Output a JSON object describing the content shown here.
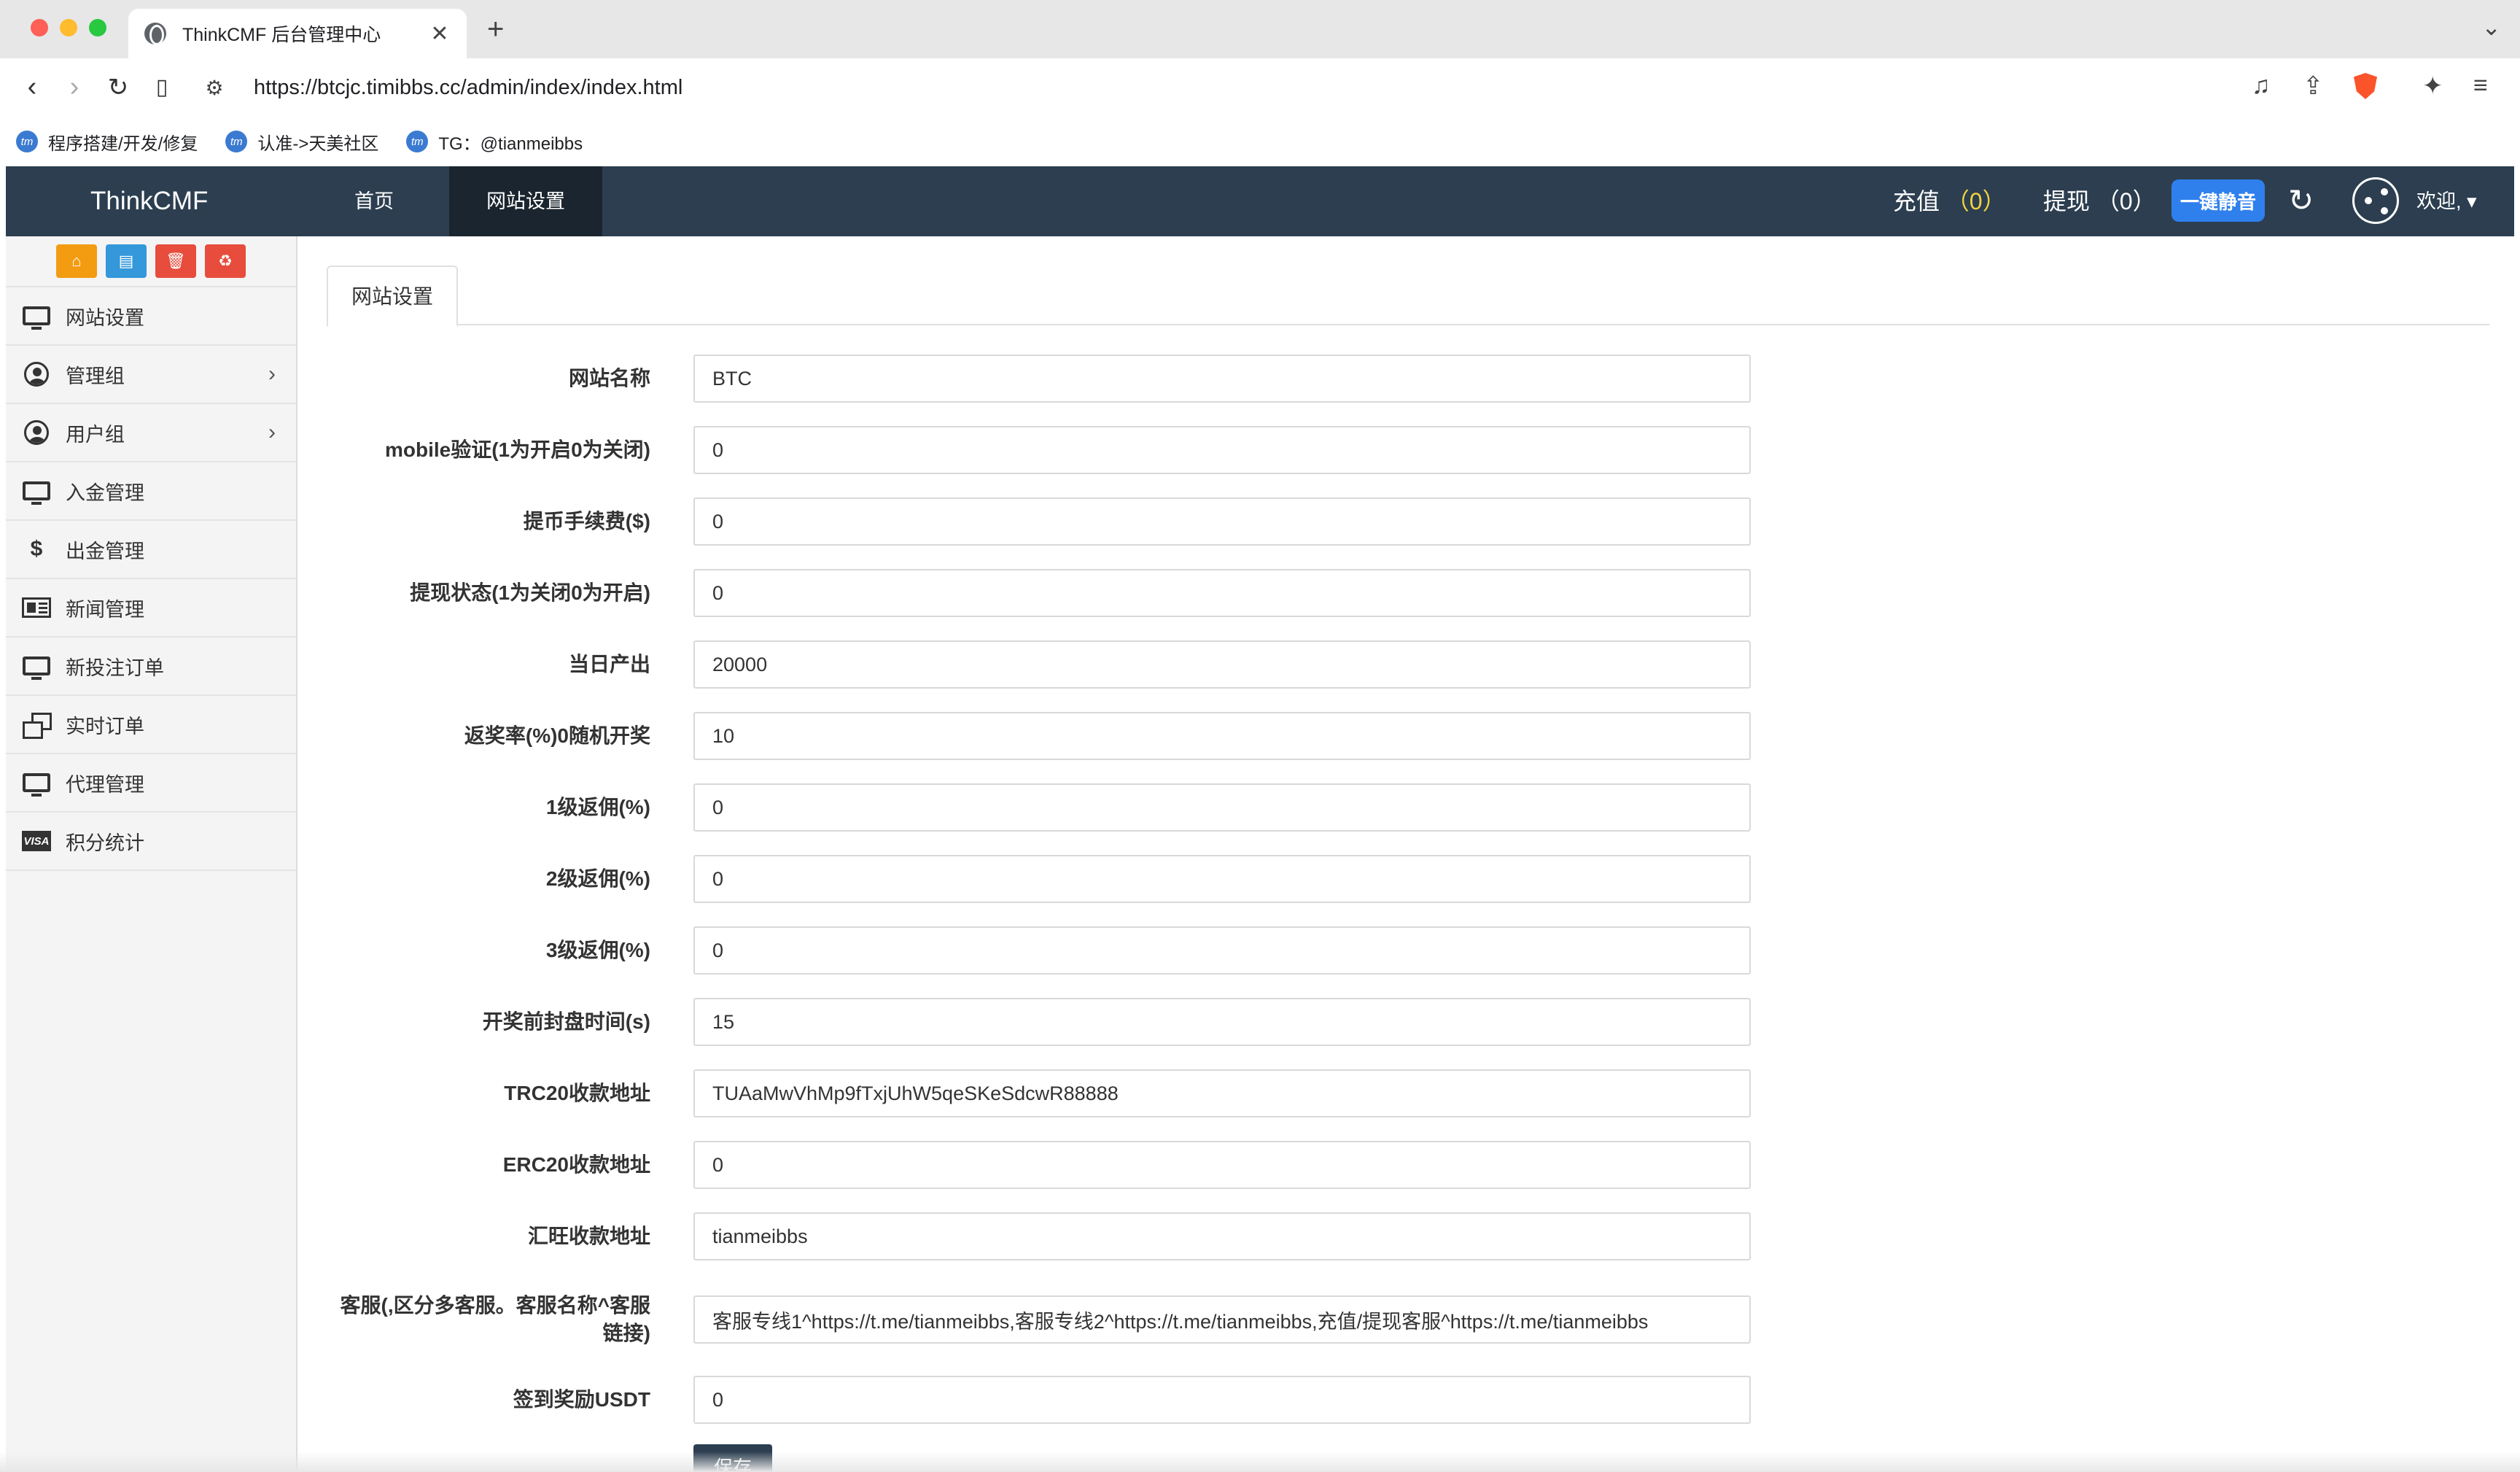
{
  "browser": {
    "tab_title": "ThinkCMF 后台管理中心",
    "tab_close": "✕",
    "new_tab": "+",
    "url": "https://btcjc.timibbs.cc/admin/index/index.html",
    "bookmarks": [
      {
        "label": "程序搭建/开发/修复"
      },
      {
        "label": "认准->天美社区"
      },
      {
        "label": "TG：@tianmeibbs"
      }
    ]
  },
  "navbar": {
    "brand": "ThinkCMF",
    "home": "首页",
    "site_settings": "网站设置",
    "recharge_label": "充值",
    "recharge_count": "0",
    "withdraw_label": "提现",
    "withdraw_count": "0",
    "mute_button": "一键静音",
    "welcome": "欢迎,"
  },
  "sidebar": {
    "items": [
      {
        "label": "网站设置",
        "icon": "monitor-icon"
      },
      {
        "label": "管理组",
        "icon": "user-circle-icon",
        "has_children": true
      },
      {
        "label": "用户组",
        "icon": "user-circle-icon",
        "has_children": true
      },
      {
        "label": "入金管理",
        "icon": "monitor-icon"
      },
      {
        "label": "出金管理",
        "icon": "dollar-icon"
      },
      {
        "label": "新闻管理",
        "icon": "newspaper-icon"
      },
      {
        "label": "新投注订单",
        "icon": "monitor-icon"
      },
      {
        "label": "实时订单",
        "icon": "clone-icon"
      },
      {
        "label": "代理管理",
        "icon": "monitor-icon"
      },
      {
        "label": "积分统计",
        "icon": "visa-icon"
      }
    ]
  },
  "page": {
    "tab": "网站设置",
    "fields": [
      {
        "label": "网站名称",
        "value": "BTC"
      },
      {
        "label": "mobile验证(1为开启0为关闭)",
        "value": "0"
      },
      {
        "label": "提币手续费($)",
        "value": "0"
      },
      {
        "label": "提现状态(1为关闭0为开启)",
        "value": "0"
      },
      {
        "label": "当日产出",
        "value": "20000"
      },
      {
        "label": "返奖率(%)0随机开奖",
        "value": "10"
      },
      {
        "label": "1级返佣(%)",
        "value": "0"
      },
      {
        "label": "2级返佣(%)",
        "value": "0"
      },
      {
        "label": "3级返佣(%)",
        "value": "0"
      },
      {
        "label": "开奖前封盘时间(s)",
        "value": "15"
      },
      {
        "label": "TRC20收款地址",
        "value": "TUAaMwVhMp9fTxjUhW5qeSKeSdcwR88888"
      },
      {
        "label": "ERC20收款地址",
        "value": "0"
      },
      {
        "label": "汇旺收款地址",
        "value": "tianmeibbs"
      },
      {
        "label": "客服(,区分多客服。客服名称^客服链接)",
        "value": "客服专线1^https://t.me/tianmeibbs,客服专线2^https://t.me/tianmeibbs,充值/提现客服^https://t.me/tianmeibbs"
      },
      {
        "label": "签到奖励USDT",
        "value": "0"
      }
    ],
    "save_button": "保存"
  },
  "colors": {
    "navbar_bg": "#2c3e50",
    "navbar_active": "#1a252f",
    "counter_highlight": "#f3d23d",
    "mute_button": "#2f80ed",
    "shortcut_orange": "#f39c12",
    "shortcut_blue": "#3498db",
    "shortcut_red": "#e74c3c"
  }
}
